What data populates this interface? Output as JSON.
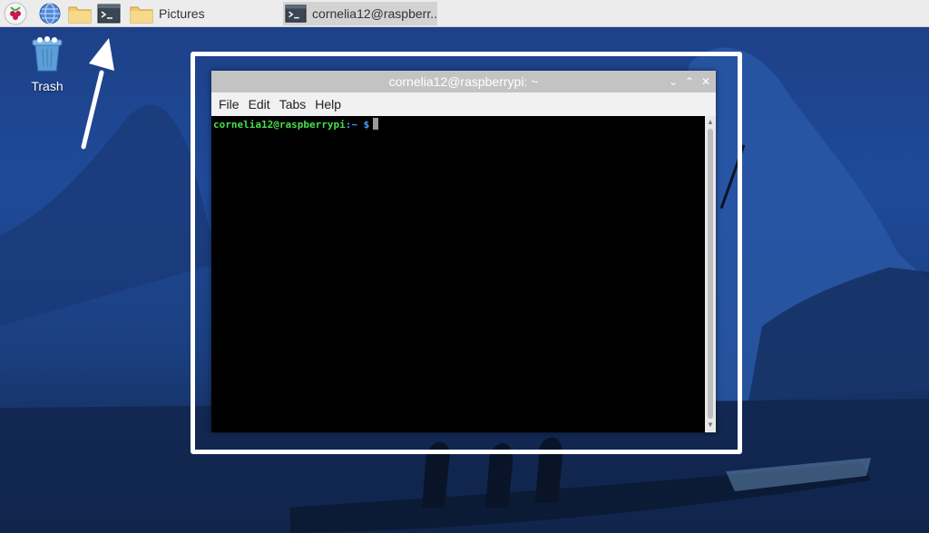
{
  "taskbar": {
    "menu_icon": "raspberry-pi-icon",
    "launchers": [
      {
        "icon": "globe-icon"
      },
      {
        "icon": "folder-icon"
      },
      {
        "icon": "terminal-icon"
      }
    ],
    "windows": [
      {
        "icon": "folder-icon",
        "label": "Pictures"
      },
      {
        "icon": "terminal-icon",
        "label": "cornelia12@raspberr.."
      }
    ]
  },
  "desktop": {
    "trash": {
      "icon": "trash-icon",
      "label": "Trash"
    }
  },
  "terminal": {
    "title": "cornelia12@raspberrypi: ~",
    "menu": [
      "File",
      "Edit",
      "Tabs",
      "Help"
    ],
    "prompt": {
      "user_host": "cornelia12@raspberrypi",
      "separator": ":",
      "path": "~",
      "sign": "$"
    },
    "controls": {
      "minimize": "⌄",
      "maximize": "⌃",
      "close": "✕"
    }
  },
  "colors": {
    "taskbar_bg": "#ececec",
    "titlebar_bg": "#c3c3c3",
    "prompt_user": "#4ade4a",
    "prompt_path": "#4aa0ff",
    "annotation": "#ffffff"
  }
}
